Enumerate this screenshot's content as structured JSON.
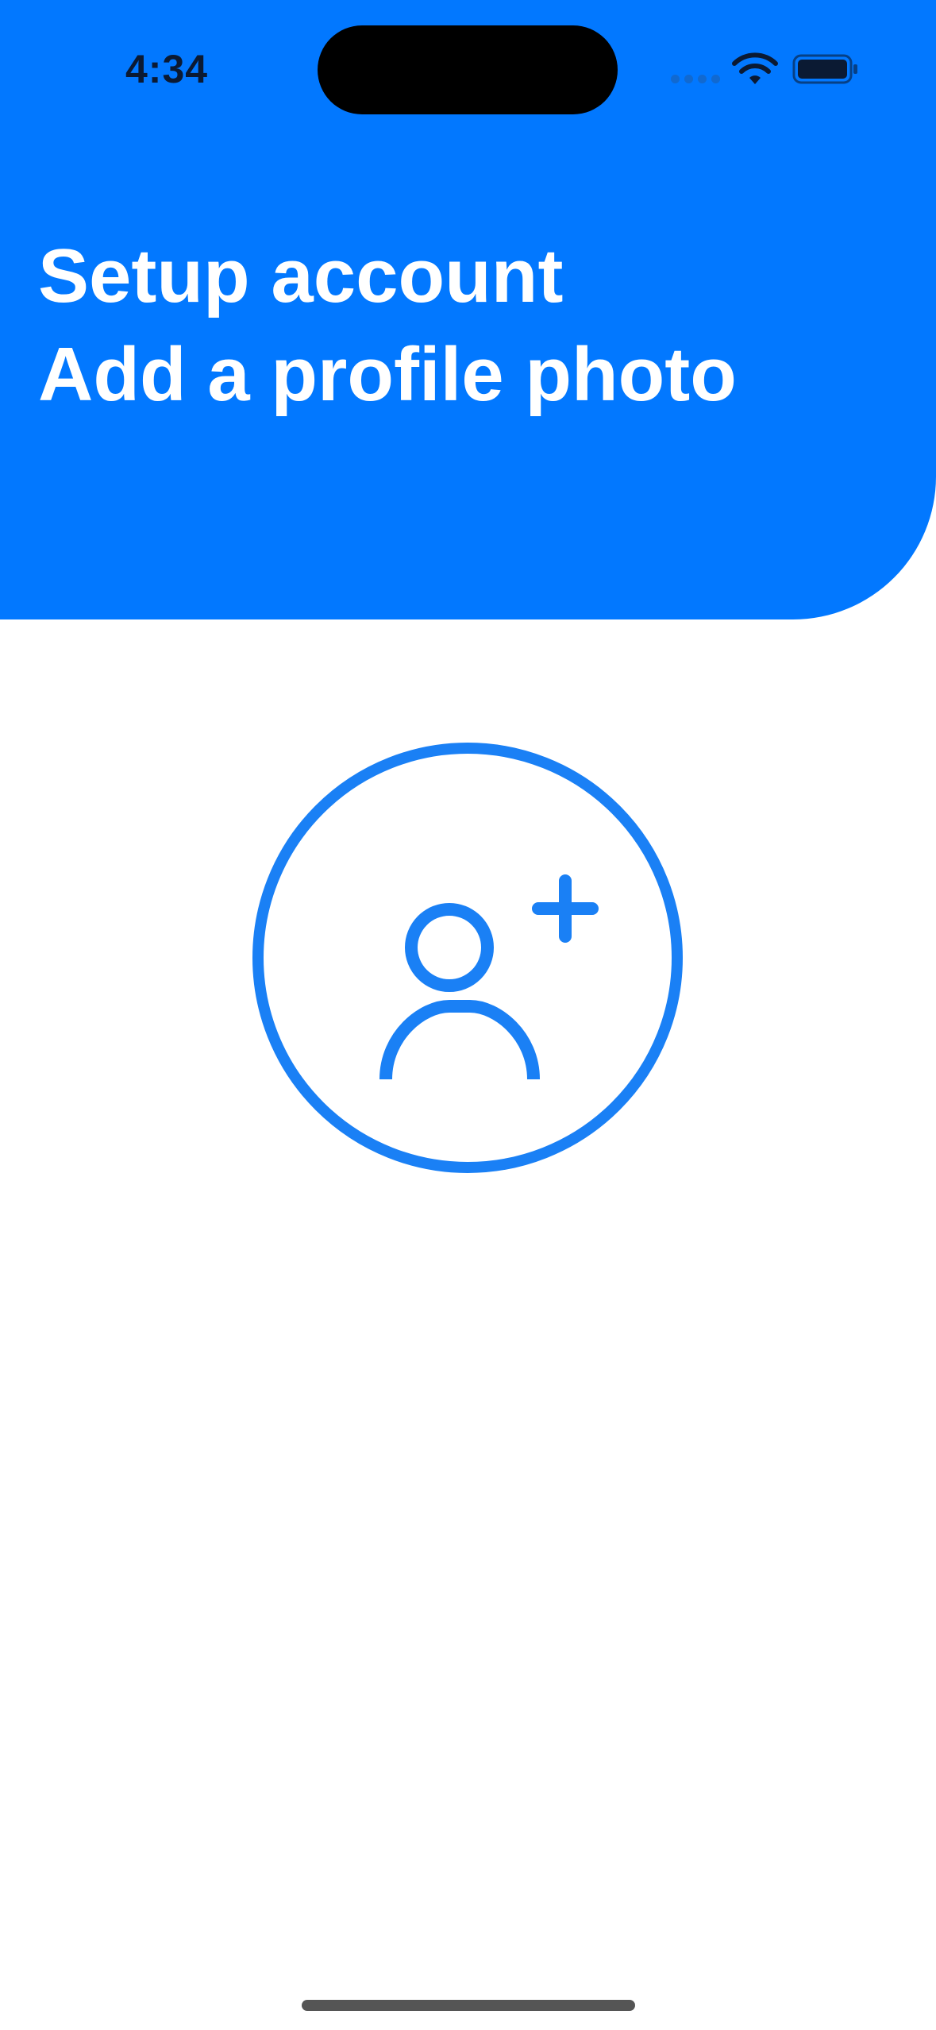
{
  "status_bar": {
    "time": "4:34",
    "wifi_icon": "wifi-icon",
    "battery_icon": "battery-icon",
    "text_color": "#0b1a33"
  },
  "header": {
    "title": "Setup account",
    "subtitle": "Add a profile photo",
    "background": "#0278FF",
    "text_color": "#ffffff"
  },
  "avatar": {
    "icon": "person-add-icon",
    "accent": "#1A80F5"
  }
}
